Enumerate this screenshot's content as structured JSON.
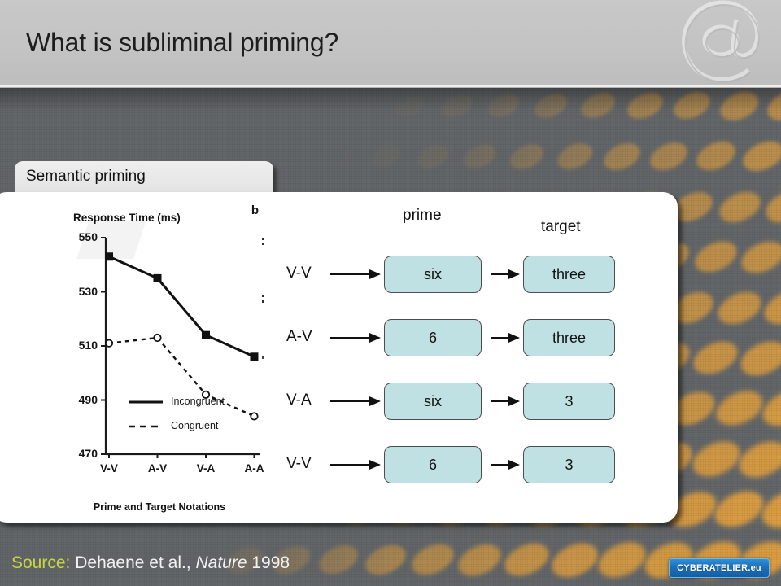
{
  "header": {
    "title": "What is subliminal priming?",
    "watermark_icon": "at-sign-watermark"
  },
  "tab": {
    "label": "Semantic priming"
  },
  "footer": {
    "source_label": "Source:",
    "source_ref_part1": "Dehaene et al.,",
    "source_ref_italic": "Nature",
    "source_ref_part2": "1998",
    "brand_logo_text": "CYBERATELIER.eu"
  },
  "diagram": {
    "column_headers": [
      "prime",
      "target"
    ],
    "rows": [
      {
        "label": "V-V",
        "prime": "six",
        "target": "three"
      },
      {
        "label": "A-V",
        "prime": "6",
        "target": "three"
      },
      {
        "label": "V-A",
        "prime": "six",
        "target": "3"
      },
      {
        "label": "V-V",
        "prime": "6",
        "target": "3"
      }
    ]
  },
  "chart_data": {
    "type": "line",
    "title": "",
    "panel_letter": "b",
    "ylabel": "Response Time (ms)",
    "xlabel": "Prime and Target Notations",
    "categories": [
      "V-V",
      "A-V",
      "V-A",
      "A-A"
    ],
    "yticks": [
      470,
      490,
      510,
      530,
      550
    ],
    "ylim": [
      470,
      550
    ],
    "grid": false,
    "legend_position": "inside-bottom-left",
    "series": [
      {
        "name": "Incongruent",
        "values": [
          543,
          535,
          514,
          506
        ],
        "style": "solid",
        "marker": "filled-square"
      },
      {
        "name": "Congruent",
        "values": [
          511,
          513,
          492,
          484
        ],
        "style": "dashed",
        "marker": "open-circle"
      }
    ]
  },
  "colors": {
    "background_gray": "#636668",
    "dot_orange": "#e8a33d",
    "header_gray": "#c3c3c3",
    "token_fill": "#bfe1e3",
    "source_label": "#c9d642",
    "brand_blue": "#1c6fb8"
  }
}
